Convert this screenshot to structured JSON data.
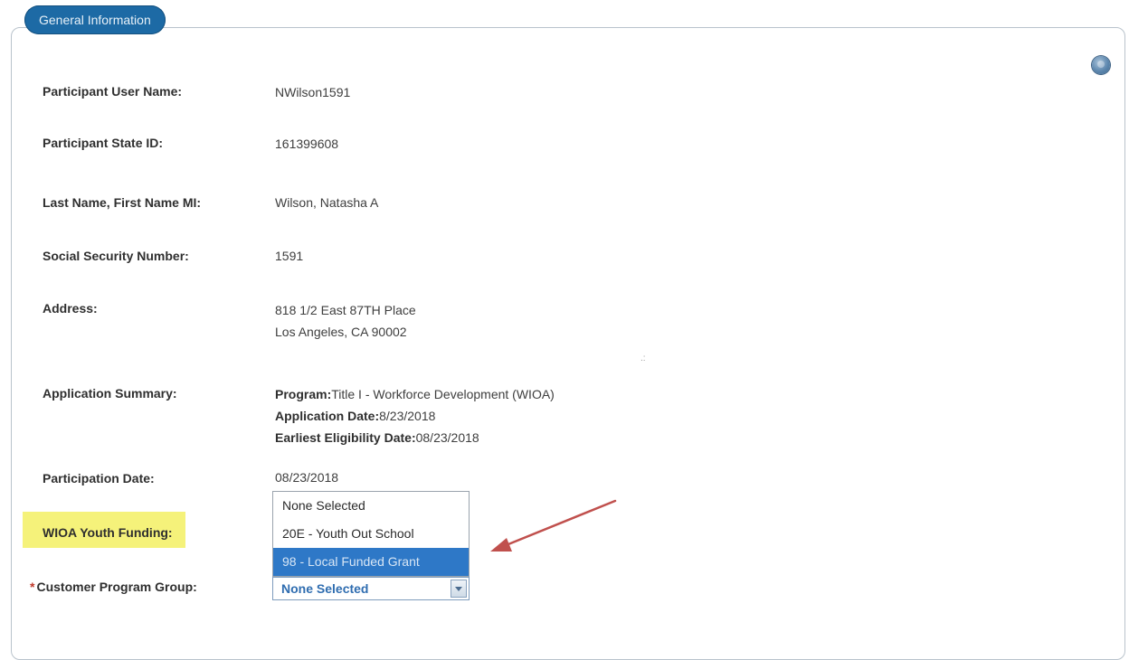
{
  "section_tab": "General Information",
  "fields": {
    "user_name": {
      "label": "Participant User Name:",
      "value": "NWilson1591"
    },
    "state_id": {
      "label": "Participant State ID:",
      "value": "161399608"
    },
    "name": {
      "label": "Last Name, First Name MI:",
      "value": "Wilson, Natasha A"
    },
    "ssn": {
      "label": "Social Security Number:",
      "value": "1591"
    },
    "address": {
      "label": "Address:",
      "line1": "818 1/2 East 87TH Place",
      "line2": "Los Angeles, CA 90002"
    },
    "application_summary": {
      "label": "Application Summary:",
      "program_label": "Program:",
      "program_value": "Title I - Workforce Development (WIOA)",
      "app_date_label": "Application Date:",
      "app_date_value": "8/23/2018",
      "eligibility_label": "Earliest Eligibility Date:",
      "eligibility_value": "08/23/2018"
    },
    "participation_date": {
      "label": "Participation Date:",
      "value": "08/23/2018"
    },
    "wioa_youth_funding": {
      "label": "WIOA Youth Funding:"
    },
    "customer_program_group": {
      "required_mark": "*",
      "label": "Customer Program Group:",
      "selected": "None Selected"
    }
  },
  "dropdown_options": [
    "None Selected",
    "20E - Youth Out School",
    "98 - Local Funded Grant"
  ],
  "colors": {
    "tab_bg": "#1d6aa5",
    "highlight": "#f5f27a",
    "option_selected_bg": "#2e78c7",
    "arrow": "#c0504d",
    "select_text": "#2f6db0"
  }
}
